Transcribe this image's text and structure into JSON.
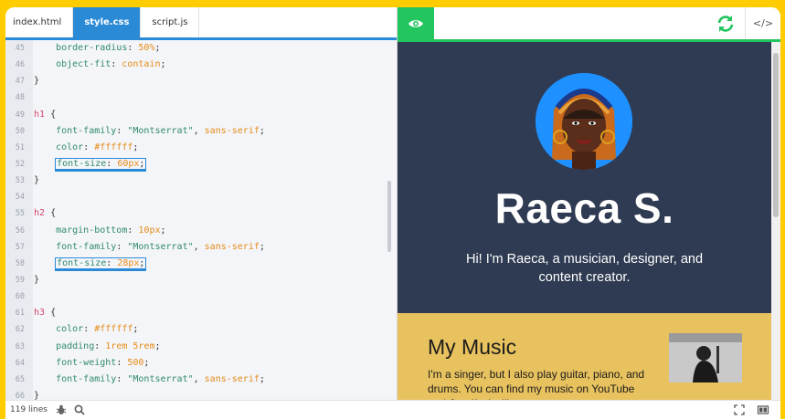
{
  "editor": {
    "tabs": [
      {
        "label": "index.html",
        "active": false
      },
      {
        "label": "style.css",
        "active": true
      },
      {
        "label": "script.js",
        "active": false
      }
    ],
    "lines": [
      {
        "n": "45",
        "parts": [
          [
            "prop",
            "    border-radius"
          ],
          [
            "br",
            ": "
          ],
          [
            "val",
            "50%"
          ],
          [
            "br",
            ";"
          ]
        ]
      },
      {
        "n": "46",
        "parts": [
          [
            "prop",
            "    object-fit"
          ],
          [
            "br",
            ": "
          ],
          [
            "val",
            "contain"
          ],
          [
            "br",
            ";"
          ]
        ]
      },
      {
        "n": "47",
        "parts": [
          [
            "br",
            "}"
          ]
        ]
      },
      {
        "n": "48",
        "parts": []
      },
      {
        "n": "49",
        "parts": [
          [
            "sel",
            "h1"
          ],
          [
            "br",
            " {"
          ]
        ]
      },
      {
        "n": "50",
        "parts": [
          [
            "prop",
            "    font-family"
          ],
          [
            "br",
            ": "
          ],
          [
            "str",
            "\"Montserrat\""
          ],
          [
            "br",
            ", "
          ],
          [
            "val",
            "sans-serif"
          ],
          [
            "br",
            ";"
          ]
        ]
      },
      {
        "n": "51",
        "parts": [
          [
            "prop",
            "    color"
          ],
          [
            "br",
            ": "
          ],
          [
            "val",
            "#ffffff"
          ],
          [
            "br",
            ";"
          ]
        ]
      },
      {
        "n": "52",
        "hl": true,
        "parts": [
          [
            "prop",
            "font-size"
          ],
          [
            "br",
            ": "
          ],
          [
            "val",
            "60px"
          ],
          [
            "br",
            ";"
          ]
        ]
      },
      {
        "n": "53",
        "parts": [
          [
            "br",
            "}"
          ]
        ]
      },
      {
        "n": "54",
        "parts": []
      },
      {
        "n": "55",
        "parts": [
          [
            "sel",
            "h2"
          ],
          [
            "br",
            " {"
          ]
        ]
      },
      {
        "n": "56",
        "parts": [
          [
            "prop",
            "    margin-bottom"
          ],
          [
            "br",
            ": "
          ],
          [
            "val",
            "10px"
          ],
          [
            "br",
            ";"
          ]
        ]
      },
      {
        "n": "57",
        "parts": [
          [
            "prop",
            "    font-family"
          ],
          [
            "br",
            ": "
          ],
          [
            "str",
            "\"Montserrat\""
          ],
          [
            "br",
            ", "
          ],
          [
            "val",
            "sans-serif"
          ],
          [
            "br",
            ";"
          ]
        ]
      },
      {
        "n": "58",
        "hl": true,
        "parts": [
          [
            "prop",
            "font-size"
          ],
          [
            "br",
            ": "
          ],
          [
            "val",
            "28px"
          ],
          [
            "br",
            ";"
          ]
        ]
      },
      {
        "n": "59",
        "parts": [
          [
            "br",
            "}"
          ]
        ]
      },
      {
        "n": "60",
        "parts": []
      },
      {
        "n": "61",
        "parts": [
          [
            "sel",
            "h3"
          ],
          [
            "br",
            " {"
          ]
        ]
      },
      {
        "n": "62",
        "parts": [
          [
            "prop",
            "    color"
          ],
          [
            "br",
            ": "
          ],
          [
            "val",
            "#ffffff"
          ],
          [
            "br",
            ";"
          ]
        ]
      },
      {
        "n": "63",
        "parts": [
          [
            "prop",
            "    padding"
          ],
          [
            "br",
            ": "
          ],
          [
            "val",
            "1rem 5rem"
          ],
          [
            "br",
            ";"
          ]
        ]
      },
      {
        "n": "64",
        "parts": [
          [
            "prop",
            "    font-weight"
          ],
          [
            "br",
            ": "
          ],
          [
            "val",
            "500"
          ],
          [
            "br",
            ";"
          ]
        ]
      },
      {
        "n": "65",
        "parts": [
          [
            "prop",
            "    font-family"
          ],
          [
            "br",
            ": "
          ],
          [
            "str",
            "\"Montserrat\""
          ],
          [
            "br",
            ", "
          ],
          [
            "val",
            "sans-serif"
          ],
          [
            "br",
            ";"
          ]
        ]
      },
      {
        "n": "66",
        "parts": [
          [
            "br",
            "}"
          ]
        ]
      }
    ]
  },
  "preview": {
    "refresh_icon": "refresh-icon",
    "code_label": "</>",
    "hero": {
      "name": "Raeca S.",
      "subtitle": "Hi! I'm Raeca, a musician, designer, and content creator."
    },
    "music": {
      "title": "My Music",
      "text": "I'm a singer, but I also play guitar, piano, and drums. You can find my music on YouTube and Spotify. I will"
    }
  },
  "status": {
    "lines": "119 lines"
  },
  "colors": {
    "accent_blue": "#2b8ad6",
    "accent_green": "#22c55e",
    "hero_bg": "#2f3b52",
    "music_bg": "#e8c25e",
    "frame_bg": "#FFCC00"
  }
}
